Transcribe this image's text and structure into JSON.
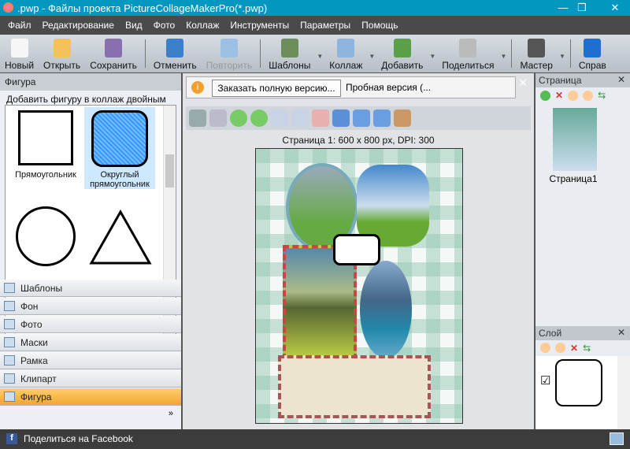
{
  "window": {
    "title": ".pwp - Файлы проекта PictureCollageMakerPro(*.pwp)",
    "min": "—",
    "max": "❐",
    "close": "✕"
  },
  "menu": [
    "Файл",
    "Редактирование",
    "Вид",
    "Фото",
    "Коллаж",
    "Инструменты",
    "Параметры",
    "Помощь"
  ],
  "toolbar": [
    {
      "label": "Новый",
      "icon": "new-file-icon",
      "color": "#f6f6f6"
    },
    {
      "label": "Открыть",
      "icon": "open-folder-icon",
      "color": "#f3c25a"
    },
    {
      "label": "Сохранить",
      "icon": "save-icon",
      "color": "#8a6fb0"
    },
    {
      "label": "Отменить",
      "icon": "undo-icon",
      "color": "#3a7fc8"
    },
    {
      "label": "Повторить",
      "icon": "redo-icon",
      "color": "#9bc0e4",
      "disabled": true
    },
    {
      "label": "Шаблоны",
      "icon": "templates-icon",
      "color": "#6a8d5a"
    },
    {
      "label": "Коллаж",
      "icon": "collage-icon",
      "color": "#8fb4de"
    },
    {
      "label": "Добавить",
      "icon": "add-photo-icon",
      "color": "#5aa04a"
    },
    {
      "label": "Поделиться",
      "icon": "printer-icon",
      "color": "#bbbbbb"
    },
    {
      "label": "Мастер",
      "icon": "wand-icon",
      "color": "#555555"
    },
    {
      "label": "Справ",
      "icon": "help-icon",
      "color": "#1e6fd0"
    }
  ],
  "left": {
    "title": "Фигура",
    "hint": "Добавить фигуру в коллаж двойным щелчком или перетаскиванием",
    "shapes": [
      "Прямоугольник",
      "Округлый прямоугольник"
    ],
    "sections": [
      "Шаблоны",
      "Фон",
      "Фото",
      "Маски",
      "Рамка",
      "Клипарт",
      "Фигура"
    ],
    "more": "»"
  },
  "notice": {
    "button": "Заказать полную версию...",
    "text": "Пробная версия (...",
    "close": "✕",
    "info": "i"
  },
  "canvas": {
    "page_info": "Страница  1: 600 x 800 px, DPI: 300"
  },
  "pages": {
    "title": "Страница",
    "close": "✕",
    "items": [
      "Страница1"
    ]
  },
  "layers": {
    "title": "Слой",
    "close": "✕",
    "checked": "☑"
  },
  "status": {
    "facebook": "Поделиться на Facebook",
    "fb": "f"
  }
}
